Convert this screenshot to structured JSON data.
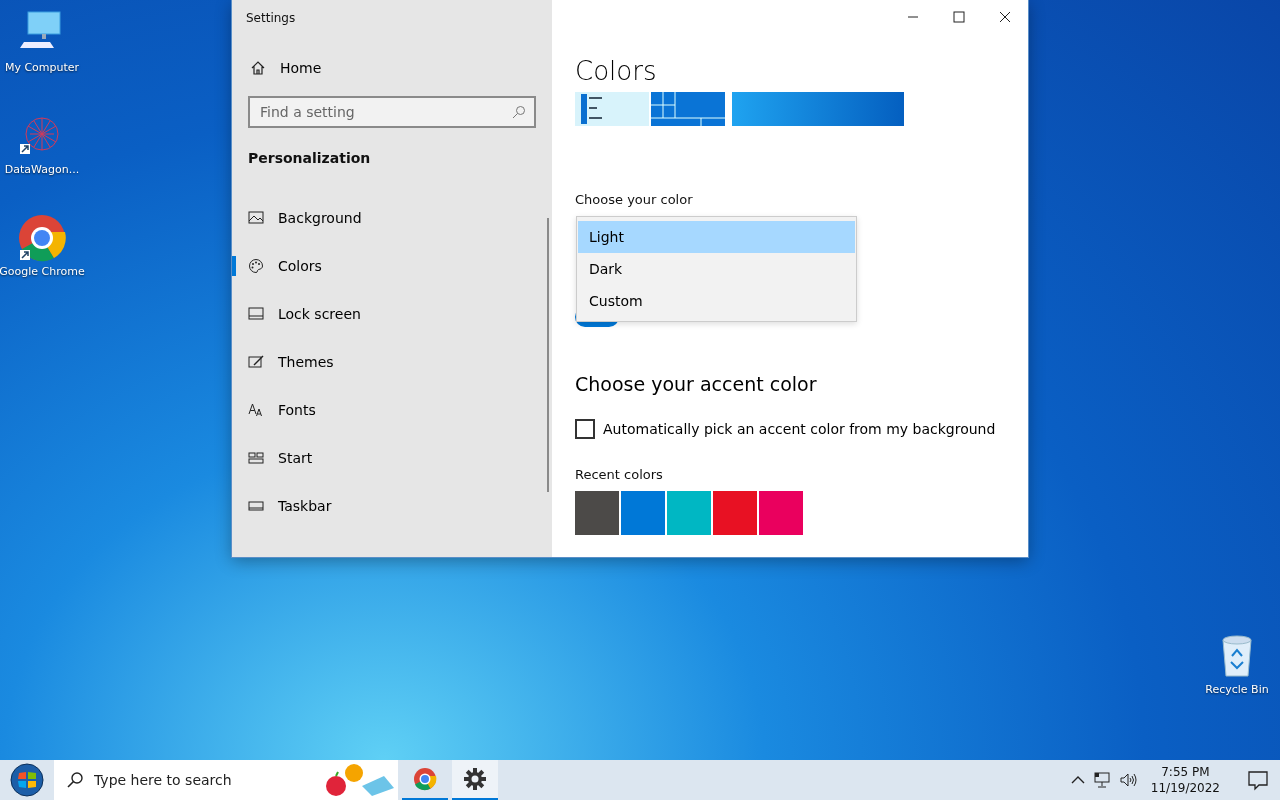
{
  "desktop": {
    "icons": [
      {
        "label": "My Computer",
        "kind": "computer"
      },
      {
        "label": "DataWagon...",
        "kind": "datawagon"
      },
      {
        "label": "Google Chrome",
        "kind": "chrome"
      },
      {
        "label": "Recycle Bin",
        "kind": "bin"
      }
    ]
  },
  "window": {
    "title": "Settings"
  },
  "sidebar": {
    "home": "Home",
    "search": {
      "placeholder": "Find a setting"
    },
    "section": "Personalization",
    "items": [
      {
        "label": "Background",
        "kind": "picture",
        "selected": false
      },
      {
        "label": "Colors",
        "kind": "palette",
        "selected": true
      },
      {
        "label": "Lock screen",
        "kind": "lock",
        "selected": false
      },
      {
        "label": "Themes",
        "kind": "themes",
        "selected": false
      },
      {
        "label": "Fonts",
        "kind": "fonts",
        "selected": false
      },
      {
        "label": "Start",
        "kind": "start",
        "selected": false
      },
      {
        "label": "Taskbar",
        "kind": "taskbar",
        "selected": false
      }
    ]
  },
  "content": {
    "heading": "Colors",
    "color_label": "Choose your color",
    "dropdown": {
      "options": [
        {
          "label": "Light",
          "selected": true
        },
        {
          "label": "Dark",
          "selected": false
        },
        {
          "label": "Custom",
          "selected": false
        }
      ]
    },
    "toggle": {
      "on": true
    },
    "accent_heading": "Choose your accent color",
    "auto_pick": {
      "label": "Automatically pick an accent color from my background",
      "checked": false
    },
    "recent_label": "Recent colors",
    "recent_colors": [
      {
        "color": "#4c4a48"
      },
      {
        "color": "#0078d7"
      },
      {
        "color": "#00b7c3"
      },
      {
        "color": "#e81123"
      },
      {
        "color": "#ea005e"
      }
    ]
  },
  "taskbar": {
    "search": {
      "placeholder": "Type here to search"
    },
    "apps": [
      {
        "kind": "chrome",
        "selected": false
      },
      {
        "kind": "settings",
        "selected": true
      }
    ],
    "time": "7:55 PM",
    "date": "11/19/2022"
  }
}
